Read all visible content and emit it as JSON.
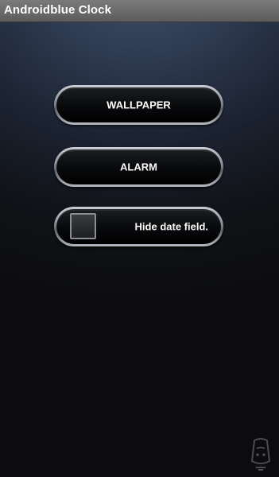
{
  "app": {
    "title": "Androidblue Clock"
  },
  "buttons": {
    "wallpaper_label": "WALLPAPER",
    "alarm_label": "ALARM"
  },
  "options": {
    "hide_date_label": "Hide date field.",
    "hide_date_checked": false
  },
  "icons": {
    "watermark": "app-store-logo-icon"
  },
  "colors": {
    "title_bar": "#6b6b6b",
    "button_face": "#0b0c0f",
    "button_rim": "#a4a8b0",
    "text": "#ffffff"
  }
}
